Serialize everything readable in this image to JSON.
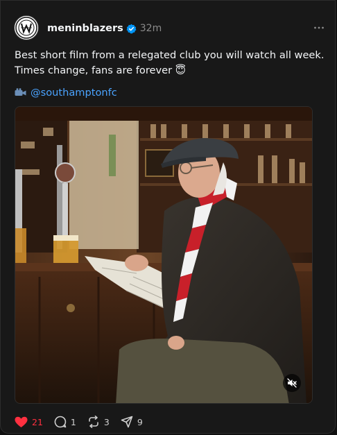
{
  "post": {
    "username": "meninblazers",
    "timestamp": "32m",
    "text_lines": [
      "Best short film from a relegated club you will watch all week.",
      "Times change, fans are forever 😇"
    ],
    "link_icon": "video-camera-icon",
    "link_text": "@southamptonfc",
    "avatar_icon": "menin-blazers-logo",
    "media_description_icon": "muted-speaker-icon",
    "actions": {
      "likes": "21",
      "replies": "1",
      "reposts": "3",
      "shares": "9"
    },
    "colors": {
      "like": "#ff3040",
      "link": "#4aa3ff",
      "verified": "#0095f6"
    }
  }
}
